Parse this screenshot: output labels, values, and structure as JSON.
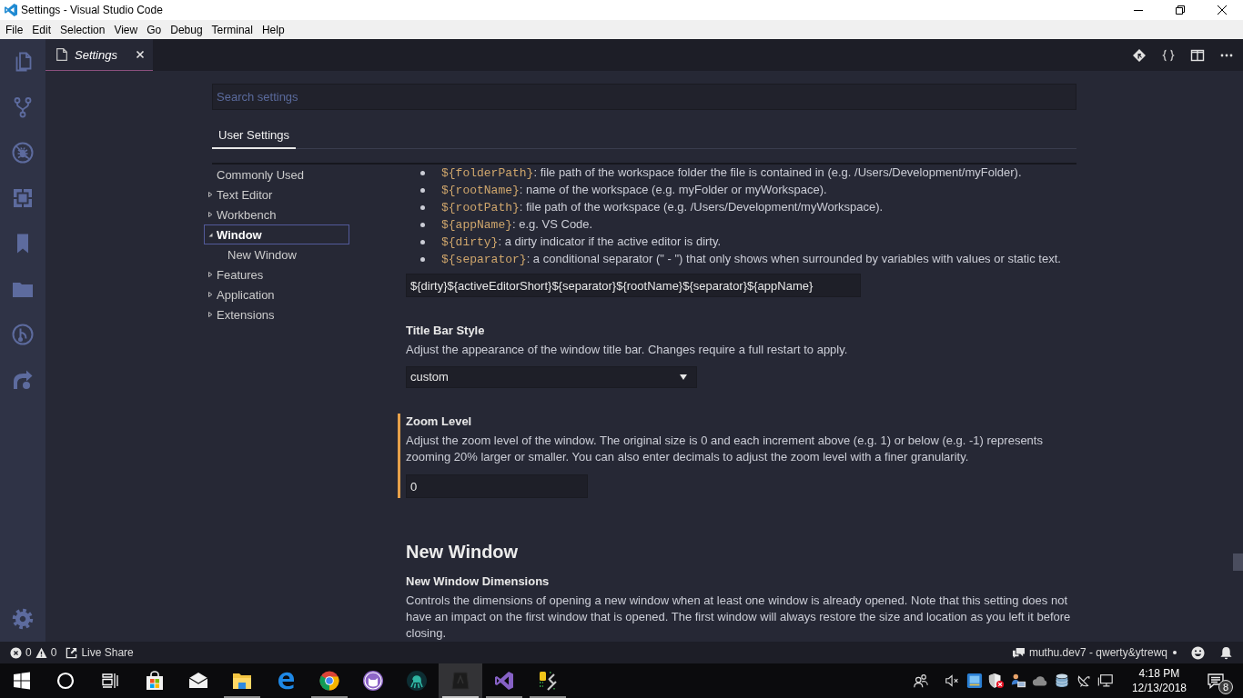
{
  "window": {
    "title": "Settings - Visual Studio Code"
  },
  "menu_bar": [
    "File",
    "Edit",
    "Selection",
    "View",
    "Go",
    "Debug",
    "Terminal",
    "Help"
  ],
  "editor_tabs": [
    {
      "label": "Settings",
      "selected": true,
      "preview": true
    }
  ],
  "search": {
    "placeholder": "Search settings"
  },
  "scope_tabs": [
    {
      "label": "User Settings",
      "selected": true
    }
  ],
  "toc": [
    {
      "label": "Commonly Used",
      "selected": false
    },
    {
      "label": "Text Editor",
      "selected": false,
      "expanded": false
    },
    {
      "label": "Workbench",
      "selected": false,
      "expanded": false
    },
    {
      "label": "Window",
      "selected": true,
      "expanded": true,
      "children": [
        {
          "label": "New Window",
          "selected": false
        }
      ]
    },
    {
      "label": "Features",
      "selected": false,
      "expanded": false
    },
    {
      "label": "Application",
      "selected": false,
      "expanded": false
    },
    {
      "label": "Extensions",
      "selected": false,
      "expanded": false
    }
  ],
  "groups": [
    {
      "settings": [
        {
          "modified": false,
          "variables": [
            {
              "variable": "${folderPath}",
              "text": ": file path of the workspace folder the file is contained in (e.g. /Users/Development/myFolder)."
            },
            {
              "variable": "${rootName}",
              "text": ": name of the workspace (e.g. myFolder or myWorkspace)."
            },
            {
              "variable": "${rootPath}",
              "text": ": file path of the workspace (e.g. /Users/Development/myWorkspace)."
            },
            {
              "variable": "${appName}",
              "text": ": e.g. VS Code."
            },
            {
              "variable": "${dirty}",
              "text": ": a dirty indicator if the active editor is dirty."
            },
            {
              "variable": "${separator}",
              "text": ": a conditional separator (\" - \") that only shows when surrounded by variables with values or static text."
            }
          ],
          "control": {
            "kind": "text",
            "value": "${dirty}${activeEditorShort}${separator}${rootName}${separator}${appName}"
          }
        },
        {
          "title": "Title Bar Style",
          "description": "Adjust the appearance of the window title bar. Changes require a full restart to apply.",
          "modified": false,
          "control": {
            "kind": "select",
            "value": "custom"
          }
        },
        {
          "title": "Zoom Level",
          "description": "Adjust the zoom level of the window. The original size is 0 and each increment above (e.g. 1) or below (e.g. -1) represents zooming 20% larger or smaller. You can also enter decimals to adjust the zoom level with a finer granularity.",
          "modified": true,
          "control": {
            "kind": "number",
            "value": "0"
          }
        }
      ]
    },
    {
      "heading": "New Window",
      "settings": [
        {
          "title": "New Window Dimensions",
          "description": "Controls the dimensions of opening a new window when at least one window is already opened. Note that this setting does not have an impact on the first window that is opened. The first window will always restore the size and location as you left it before closing.",
          "modified": false
        }
      ]
    }
  ],
  "status_bar": {
    "errors": "0",
    "warnings": "0",
    "live_share": "Live Share",
    "account": "muthu.dev7 - qwerty&ytrewq"
  },
  "taskbar": {
    "apps": [
      {
        "running": false,
        "selected": false
      },
      {
        "running": false,
        "selected": false
      },
      {
        "running": true,
        "selected": false
      },
      {
        "running": false,
        "selected": false
      },
      {
        "running": true,
        "selected": false
      },
      {
        "running": false,
        "selected": false
      },
      {
        "running": false,
        "selected": false
      },
      {
        "running": true,
        "selected": true
      },
      {
        "running": true,
        "selected": false
      },
      {
        "running": true,
        "selected": false
      }
    ],
    "time": "4:18 PM",
    "date": "12/13/2018",
    "notifications": "8"
  }
}
